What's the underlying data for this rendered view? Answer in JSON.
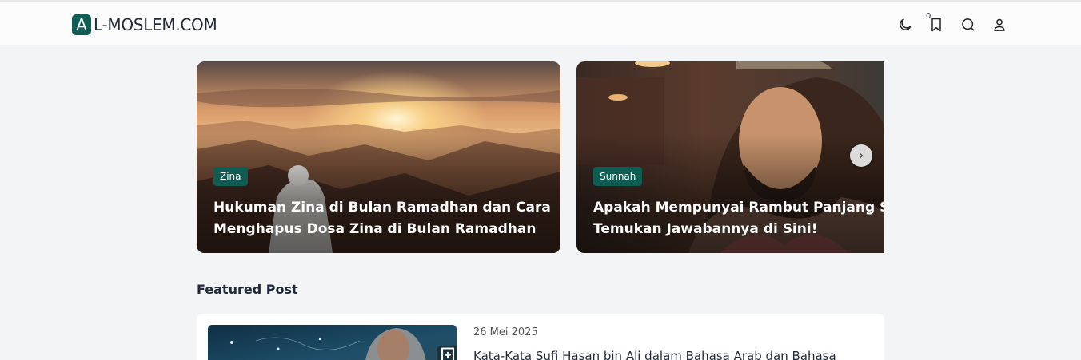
{
  "header": {
    "logo_letter": "A",
    "logo_rest": "L-MOSLEM.COM",
    "bookmark_count": "0",
    "icons": [
      "moon-icon",
      "bookmark-icon",
      "search-icon",
      "user-icon"
    ]
  },
  "slider": {
    "slides": [
      {
        "tag": "Zina",
        "title_line1": "Hukuman Zina di Bulan Ramadhan dan Cara",
        "title_line2": "Menghapus Dosa Zina di Bulan Ramadhan"
      },
      {
        "tag": "Sunnah",
        "title_line1": "Apakah Mempunyai Rambut Panjang Sunnah?",
        "title_line2": "Temukan Jawabannya di Sini!"
      }
    ],
    "next_label": "›"
  },
  "featured": {
    "section_title": "Featured Post",
    "post": {
      "date": "26 Mei 2025",
      "title": "Kata-Kata Sufi Hasan bin Ali dalam Bahasa Arab dan Bahasa"
    }
  },
  "colors": {
    "brand": "#0f5c53",
    "background": "#f3f4f6",
    "header_bg": "#fcfcfd"
  }
}
